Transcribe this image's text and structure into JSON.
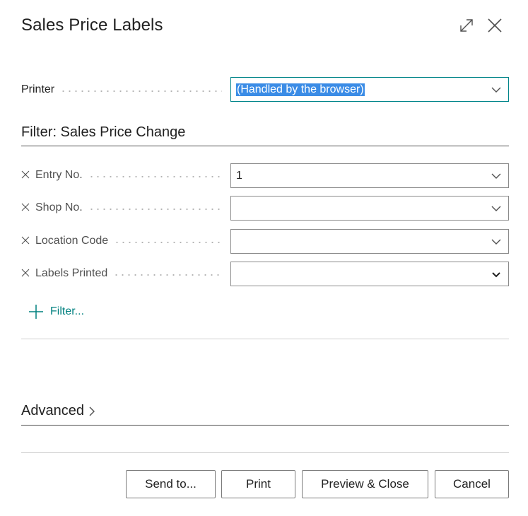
{
  "dialog": {
    "title": "Sales Price Labels"
  },
  "printer": {
    "label": "Printer",
    "value": "(Handled by the browser)"
  },
  "filter_section": {
    "title": "Filter: Sales Price Change",
    "fields": [
      {
        "label": "Entry No.",
        "value": "1"
      },
      {
        "label": "Shop No.",
        "value": ""
      },
      {
        "label": "Location Code",
        "value": ""
      },
      {
        "label": "Labels Printed",
        "value": ""
      }
    ],
    "add_filter_label": "Filter..."
  },
  "advanced": {
    "label": "Advanced"
  },
  "buttons": {
    "send_to": "Send to...",
    "print": "Print",
    "preview_close": "Preview & Close",
    "cancel": "Cancel"
  },
  "colors": {
    "accent": "#008489",
    "selection": "#3b8ce6",
    "text": "#212121"
  }
}
